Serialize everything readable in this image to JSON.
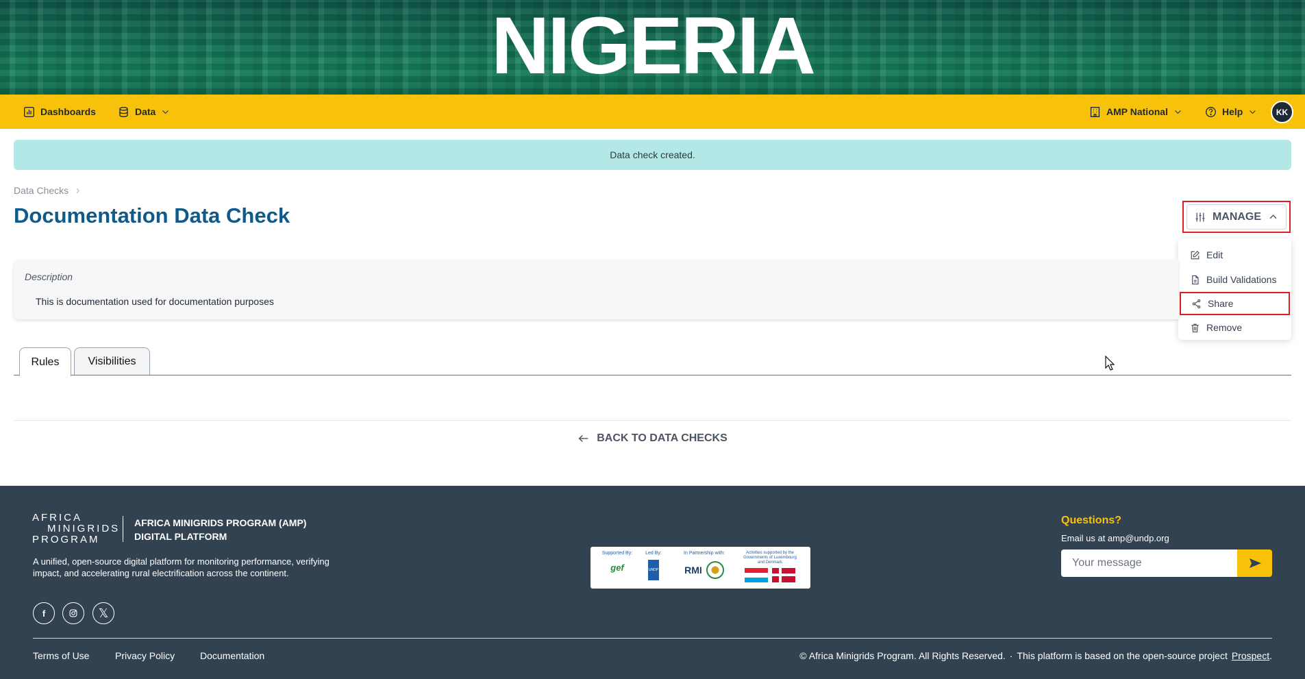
{
  "banner": {
    "title": "NIGERIA"
  },
  "nav": {
    "dashboards": "Dashboards",
    "data": "Data",
    "org": "AMP National",
    "help": "Help",
    "avatar": "KK"
  },
  "alert": {
    "message": "Data check created."
  },
  "breadcrumb": {
    "item": "Data Checks"
  },
  "page": {
    "title": "Documentation Data Check"
  },
  "manage": {
    "label": "MANAGE",
    "menu": [
      "Edit",
      "Build Validations",
      "Share",
      "Remove"
    ]
  },
  "description": {
    "label": "Description",
    "text": "This is documentation used for documentation purposes"
  },
  "tabs": [
    "Rules",
    "Visibilities"
  ],
  "back_link": "BACK TO DATA CHECKS",
  "footer": {
    "logo_lines": [
      "AFRICA",
      "MINIGRIDS",
      "PROGRAM"
    ],
    "program_title_line1": "AFRICA MINIGRIDS PROGRAM (AMP)",
    "program_title_line2": "DIGITAL PLATFORM",
    "description": "A unified, open-source digital platform for monitoring performance, verifying impact, and accelerating rural electrification across the continent.",
    "partners": {
      "supported_by": "Supported By:",
      "led_by": "Led By:",
      "partnership": "In Partnership with:",
      "activities": "Activities supported by the Governments of Luxembourg and Denmark",
      "gef": "gef",
      "undp": "UNDP",
      "rmi": "RMI"
    },
    "questions": "Questions?",
    "email": "Email us at amp@undp.org",
    "message_placeholder": "Your message",
    "links": [
      "Terms of Use",
      "Privacy Policy",
      "Documentation"
    ],
    "copyright": "© Africa Minigrids Program. All Rights Reserved.",
    "separator": "·",
    "based_on": "This platform is based on the open-source project",
    "prospect": "Prospect",
    "period": "."
  }
}
